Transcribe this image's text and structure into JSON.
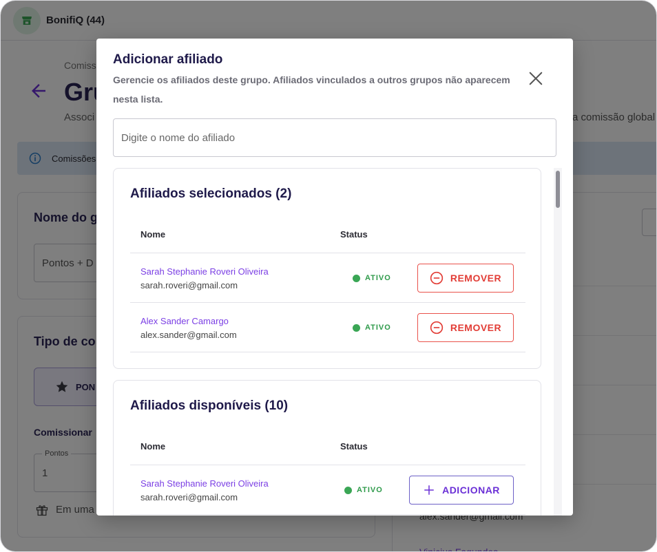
{
  "app": {
    "title": "BonifiQ (44)"
  },
  "background": {
    "breadcrumb": "Comiss",
    "page_title": "Gru",
    "subtitle_left": "Associ",
    "subtitle_right": "a comissão global",
    "info_text": "Comissões",
    "card1_title": "Nome do g",
    "card1_input": "Pontos + D",
    "card2_title": "Tipo de co",
    "chip_label": "PON",
    "commission_label": "Comissionar",
    "points_label": "Pontos",
    "points_value": "1",
    "gift_text": "Em uma",
    "right_email": "alex.sander@gmail.com",
    "right_link": "Vinicius Fagundes"
  },
  "modal": {
    "title": "Adicionar afiliado",
    "description": "Gerencie os afiliados deste grupo. Afiliados vinculados a outros grupos não aparecem nesta lista.",
    "search_placeholder": "Digite o nome do afiliado",
    "search_value": "",
    "table_headers": {
      "name": "Nome",
      "status": "Status"
    },
    "selected": {
      "title": "Afiliados selecionados (2)",
      "rows": [
        {
          "name": "Sarah Stephanie Roveri Oliveira",
          "email": "sarah.roveri@gmail.com",
          "status": "ATIVO",
          "action": "REMOVER"
        },
        {
          "name": "Alex Sander Camargo",
          "email": "alex.sander@gmail.com",
          "status": "ATIVO",
          "action": "REMOVER"
        }
      ]
    },
    "available": {
      "title": "Afiliados disponíveis (10)",
      "rows": [
        {
          "name": "Sarah Stephanie Roveri Oliveira",
          "email": "sarah.roveri@gmail.com",
          "status": "ATIVO",
          "action": "ADICIONAR"
        }
      ]
    }
  },
  "colors": {
    "accent": "#7b3fe4",
    "danger": "#e23d36",
    "success": "#3aa655",
    "title": "#1f1a4a"
  },
  "icons": {
    "app": "store-icon",
    "back": "arrow-left-icon",
    "info": "info-icon",
    "close": "close-icon",
    "remove": "minus-circle-icon",
    "add": "plus-icon",
    "star": "star-icon",
    "gift": "gift-icon"
  }
}
